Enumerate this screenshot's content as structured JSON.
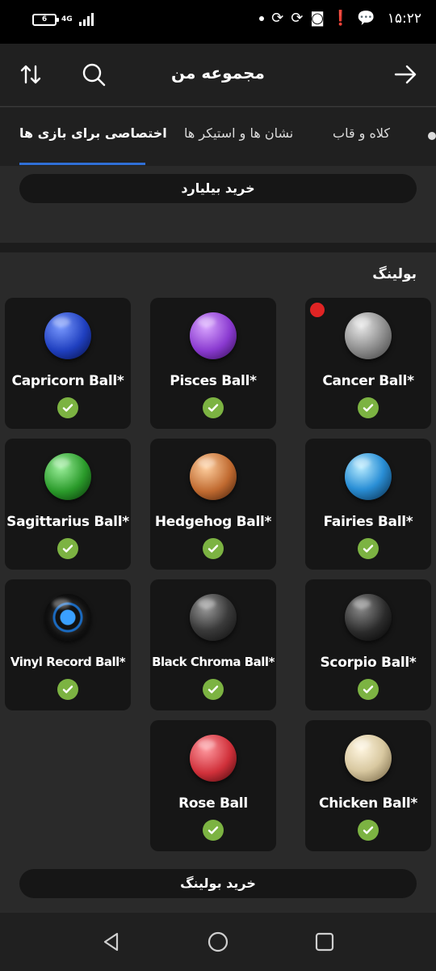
{
  "status_bar": {
    "battery": "6",
    "network": "4G",
    "time": "۱۵:۲۲"
  },
  "app_bar": {
    "title": "مجموعه من"
  },
  "tabs": [
    {
      "label": "اختصاصی برای بازی ها",
      "active": true
    },
    {
      "label": "نشان ها و استیکر ها",
      "active": false
    },
    {
      "label": "کلاه و قاب",
      "active": false
    }
  ],
  "billiard": {
    "buy_label": "خرید بیلیارد"
  },
  "bowling": {
    "title": "بولینگ",
    "buy_label": "خرید بولینگ",
    "items": [
      {
        "name": "Cancer Ball*",
        "owned": true,
        "has_new": true,
        "color": "#9a9a9a"
      },
      {
        "name": "Pisces Ball*",
        "owned": true,
        "has_new": false,
        "color": "#8a3ad0"
      },
      {
        "name": "Capricorn Ball*",
        "owned": true,
        "has_new": false,
        "color": "#1f3fbf"
      },
      {
        "name": "Fairies Ball*",
        "owned": true,
        "has_new": false,
        "color": "#2a8fd6"
      },
      {
        "name": "Hedgehog Ball*",
        "owned": true,
        "has_new": false,
        "color": "#c06a30"
      },
      {
        "name": "Sagittarius Ball*",
        "owned": true,
        "has_new": false,
        "color": "#2a9a2a"
      },
      {
        "name": "Scorpio Ball*",
        "owned": true,
        "has_new": false,
        "color": "#3a3a3a"
      },
      {
        "name": "Black Chroma Ball*",
        "owned": true,
        "has_new": false,
        "color": "#2c2c2c"
      },
      {
        "name": "Vinyl Record Ball*",
        "owned": true,
        "has_new": false,
        "color": "#111111"
      },
      {
        "name": "Chicken Ball*",
        "owned": true,
        "has_new": false,
        "color": "#d8c8a0"
      },
      {
        "name": "Rose Ball",
        "owned": true,
        "has_new": false,
        "color": "#d0303a"
      }
    ]
  },
  "colors": {
    "accent": "#2f6fd6",
    "check": "#7cb342",
    "card_bg": "#161616",
    "new_dot": "#e02424"
  }
}
